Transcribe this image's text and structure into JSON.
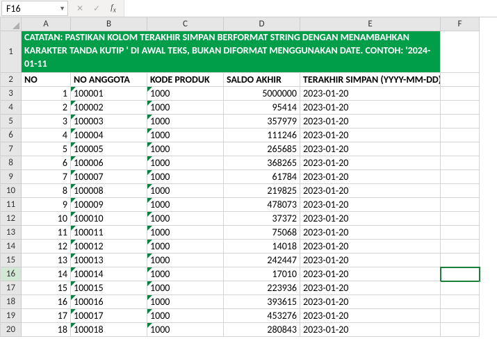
{
  "name_box": "F16",
  "formula_value": "",
  "columns": [
    "A",
    "B",
    "C",
    "D",
    "E",
    "F"
  ],
  "note": "CATATAN: PASTIKAN KOLOM TERAKHIR SIMPAN BERFORMAT STRING DENGAN MENAMBAHKAN KARAKTER TANDA KUTIP ' DI AWAL TEKS, BUKAN DIFORMAT MENGGUNAKAN DATE. CONTOH: '2024-01-11",
  "headers": {
    "no": "NO",
    "anggota": "NO ANGGOTA",
    "kode": "KODE PRODUK",
    "saldo": "SALDO AKHIR",
    "terakhir": "TERAKHIR SIMPAN (YYYY-MM-DD)"
  },
  "rows": [
    {
      "row": 3,
      "no": 1,
      "anggota": "100001",
      "kode": "1000",
      "saldo": 5000000,
      "tgl": "2023-01-20"
    },
    {
      "row": 4,
      "no": 2,
      "anggota": "100002",
      "kode": "1000",
      "saldo": 95414,
      "tgl": "2023-01-20"
    },
    {
      "row": 5,
      "no": 3,
      "anggota": "100003",
      "kode": "1000",
      "saldo": 357979,
      "tgl": "2023-01-20"
    },
    {
      "row": 6,
      "no": 4,
      "anggota": "100004",
      "kode": "1000",
      "saldo": 111246,
      "tgl": "2023-01-20"
    },
    {
      "row": 7,
      "no": 5,
      "anggota": "100005",
      "kode": "1000",
      "saldo": 265685,
      "tgl": "2023-01-20"
    },
    {
      "row": 8,
      "no": 6,
      "anggota": "100006",
      "kode": "1000",
      "saldo": 368265,
      "tgl": "2023-01-20"
    },
    {
      "row": 9,
      "no": 7,
      "anggota": "100007",
      "kode": "1000",
      "saldo": 61784,
      "tgl": "2023-01-20"
    },
    {
      "row": 10,
      "no": 8,
      "anggota": "100008",
      "kode": "1000",
      "saldo": 219825,
      "tgl": "2023-01-20"
    },
    {
      "row": 11,
      "no": 9,
      "anggota": "100009",
      "kode": "1000",
      "saldo": 478073,
      "tgl": "2023-01-20"
    },
    {
      "row": 12,
      "no": 10,
      "anggota": "100010",
      "kode": "1000",
      "saldo": 37372,
      "tgl": "2023-01-20"
    },
    {
      "row": 13,
      "no": 11,
      "anggota": "100011",
      "kode": "1000",
      "saldo": 75068,
      "tgl": "2023-01-20"
    },
    {
      "row": 14,
      "no": 12,
      "anggota": "100012",
      "kode": "1000",
      "saldo": 14018,
      "tgl": "2023-01-20"
    },
    {
      "row": 15,
      "no": 13,
      "anggota": "100013",
      "kode": "1000",
      "saldo": 242447,
      "tgl": "2023-01-20"
    },
    {
      "row": 16,
      "no": 14,
      "anggota": "100014",
      "kode": "1000",
      "saldo": 17010,
      "tgl": "2023-01-20"
    },
    {
      "row": 17,
      "no": 15,
      "anggota": "100015",
      "kode": "1000",
      "saldo": 223936,
      "tgl": "2023-01-20"
    },
    {
      "row": 18,
      "no": 16,
      "anggota": "100016",
      "kode": "1000",
      "saldo": 393615,
      "tgl": "2023-01-20"
    },
    {
      "row": 19,
      "no": 17,
      "anggota": "100017",
      "kode": "1000",
      "saldo": 453276,
      "tgl": "2023-01-20"
    },
    {
      "row": 20,
      "no": 18,
      "anggota": "100018",
      "kode": "1000",
      "saldo": 280843,
      "tgl": "2023-01-20"
    }
  ],
  "active_cell_row": 16
}
